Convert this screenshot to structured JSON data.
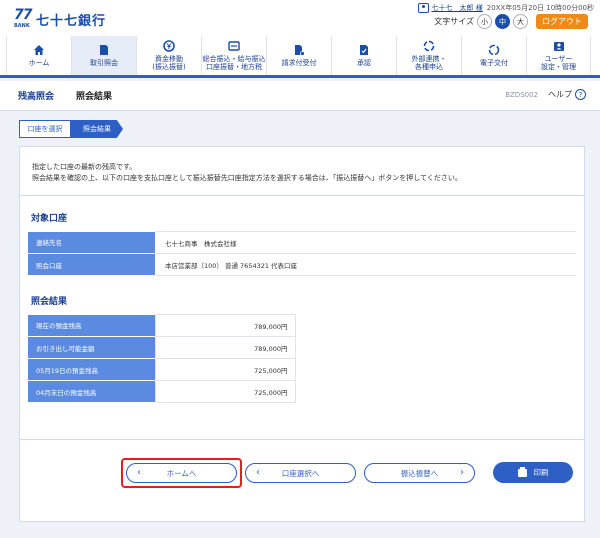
{
  "header": {
    "bank_logo_number": "77",
    "bank_logo_sub": "BANK",
    "bank_name": "七十七銀行",
    "user_name": "七十七　太郎 様",
    "timestamp": "20XX年05月20日 10時00分00秒",
    "font_size_label": "文字サイズ",
    "font_sizes": [
      "小",
      "中",
      "大"
    ],
    "font_size_selected": "中",
    "logout_label": "ログアウト"
  },
  "nav": {
    "items": [
      {
        "label": "ホーム",
        "icon": "home-icon"
      },
      {
        "label": "取引照会",
        "icon": "document-icon"
      },
      {
        "label": "資金移動\n(振込振替)",
        "icon": "yen-transfer-icon"
      },
      {
        "label": "総合振込・給与振込\n口座振替・地方税",
        "icon": "batch-transfer-icon"
      },
      {
        "label": "請求付受付",
        "icon": "person-doc-icon"
      },
      {
        "label": "承認",
        "icon": "approval-icon"
      },
      {
        "label": "外部連携・\n各種申込",
        "icon": "link-icon"
      },
      {
        "label": "電子交付",
        "icon": "refresh-icon"
      },
      {
        "label": "ユーザー\n設定・管理",
        "icon": "user-settings-icon"
      }
    ],
    "active_index": 1
  },
  "page": {
    "section": "残高照会",
    "title": "照会結果",
    "screen_code": "BZDS002",
    "help_label": "ヘルプ"
  },
  "steps": [
    "口座を選択",
    "照会結果"
  ],
  "message": {
    "line1": "指定した口座の最新の残高です。",
    "line2": "照会結果を確認の上、以下の口座を支払口座として振込振替先口座指定方法を選択する場合は、「振込振替へ」ボタンを押してください。"
  },
  "target_account": {
    "title": "対象口座",
    "rows": [
      {
        "label": "連絡先名",
        "value": "七十七商事　株式会社様"
      },
      {
        "label": "照会口座",
        "value": "本店営業部（100） 普通 7654321 代表口座"
      }
    ]
  },
  "result": {
    "title": "照会結果",
    "rows": [
      {
        "label": "現在の預金残高",
        "value": "789,000円"
      },
      {
        "label": "お引き出し可能金額",
        "value": "789,000円"
      },
      {
        "label": "05月19日の預金残高",
        "value": "725,000円"
      },
      {
        "label": "04月末日の預金残高",
        "value": "725,000円"
      }
    ]
  },
  "buttons": {
    "home": "ホームへ",
    "account_select": "口座選択へ",
    "transfer": "振込振替へ",
    "print": "印刷"
  },
  "colors": {
    "brand_blue": "#1a4ea8",
    "accent_blue": "#2d5fc4",
    "table_header": "#5b8be1",
    "logout_orange": "#f08a16",
    "highlight_red": "#e02020"
  }
}
